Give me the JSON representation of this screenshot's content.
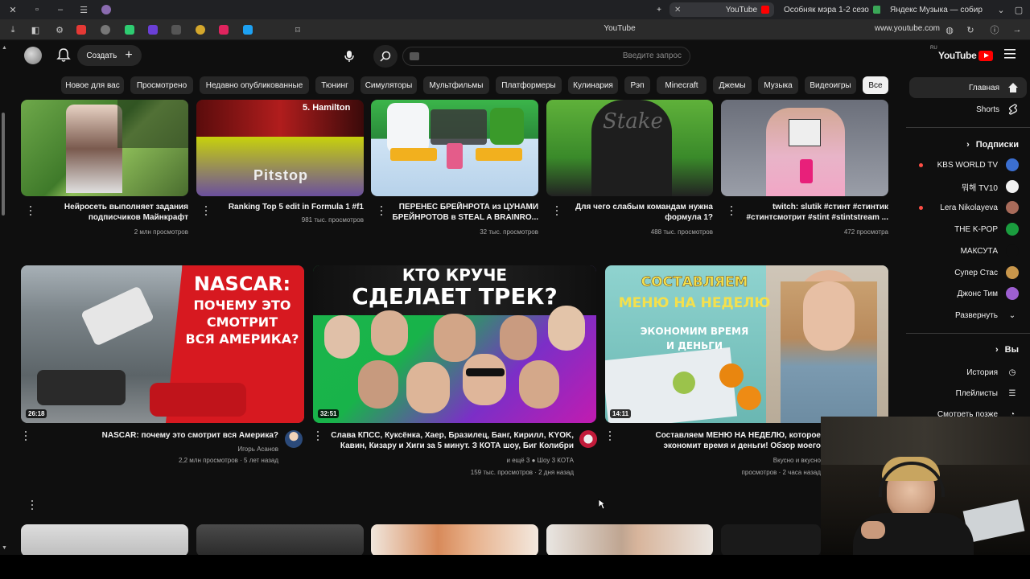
{
  "browser": {
    "tabs": [
      {
        "label": "YouTube",
        "active": true
      },
      {
        "label": "Особняк мэра 1-2 сезо"
      },
      {
        "label": "Яндекс Музыка — собир"
      }
    ],
    "page_title": "YouTube",
    "url": "www.youtube.com"
  },
  "header": {
    "create_label": "Создать",
    "search_placeholder": "Введите запрос",
    "logo_text": "YouTube",
    "logo_region": "RU"
  },
  "chips": [
    "Все",
    "Видеоигры",
    "Музыка",
    "Джемы",
    "Minecraft",
    "Рэп",
    "Кулинария",
    "Платформеры",
    "Мультфильмы",
    "Симуляторы",
    "Тюнинг",
    "Недавно опубликованные",
    "Просмотрено",
    "Новое для вас"
  ],
  "sidebar": {
    "home": "Главная",
    "shorts": "Shorts",
    "subs_header": "Подписки",
    "channels": [
      "KBS WORLD TV",
      "뭐해 TV10",
      "Lera Nikolayeva",
      "THE K-POP",
      "МАКСУТА",
      "Супер Стас",
      "Джонс Тим"
    ],
    "expand": "Развернуть",
    "you_header": "Вы",
    "history": "История",
    "playlists": "Плейлисты",
    "watch_later": "Смотреть позже"
  },
  "row1": [
    {
      "title": "Нейросеть выполняет задания подписчиков Майнкрафт",
      "meta": "2 млн просмотров"
    },
    {
      "title": "Ranking Top 5 edit in Formula 1 #f1",
      "meta": "981 тыс. просмотров",
      "thumb_text": "5. Hamilton",
      "thumb_brand": "Pitstop"
    },
    {
      "title": "ПЕРЕНЕС БРЕЙНРОТА из ЦУНАМИ БРЕЙНРОТОВ в STEAL A BRAINRO...",
      "meta": "32 тыс. просмотров"
    },
    {
      "title": "Для чего слабым командам нужна формула 1?",
      "meta": "488 тыс. просмотров",
      "thumb_text": "Stake"
    },
    {
      "title": "twitch: slutik #стинт #стинтик #стинтсмотрит #stint #stintstream ...",
      "meta": "472 просмотра"
    }
  ],
  "row2": [
    {
      "title": "NASCAR: почему это смотрит вся Америка?",
      "channel": "Игорь Асанов",
      "meta": "2,2 млн просмотров · 5 лет назад",
      "duration": "26:18",
      "thumb_lines": [
        "NASCAR:",
        "ПОЧЕМУ ЭТО",
        "СМОТРИТ",
        "ВСЯ АМЕРИКА?"
      ]
    },
    {
      "title": "Слава КПСС, Куксёнка, Хаер, Бразилец, Банг, Кирилл, KYOK, Кавин, Кизару и Хиги за 5 минут. З КОТА шоу, Биг Колибри",
      "channel": "Шоу 3 КОТА",
      "channel_extra": "и ещё 3",
      "meta": "159 тыс. просмотров · 2 дня назад",
      "duration": "32:51",
      "thumb_lines": [
        "КТО КРУЧЕ",
        "СДЕЛАЕТ ТРЕК?"
      ]
    },
    {
      "title": "Составляем МЕНЮ НА НЕДЕЛЮ, которое экономит время и деньги! Обзор моего холодильника и запасов.",
      "channel": "Вкусно и вкусно",
      "meta": "просмотров · 2 часа назад",
      "duration": "14:11",
      "thumb_lines": [
        "СОСТАВЛЯЕМ",
        "МЕНЮ НА НЕДЕЛЮ",
        "ЭКОНОМИМ ВРЕМЯ",
        "И ДЕНЬГИ"
      ]
    }
  ],
  "colors": {
    "bg": "#0f0f0f",
    "chip": "#272727",
    "accent_red": "#ff0000",
    "nascar_red": "#d71920",
    "trek_green": "#18b34a",
    "menu_teal": "#7fc8c3"
  }
}
